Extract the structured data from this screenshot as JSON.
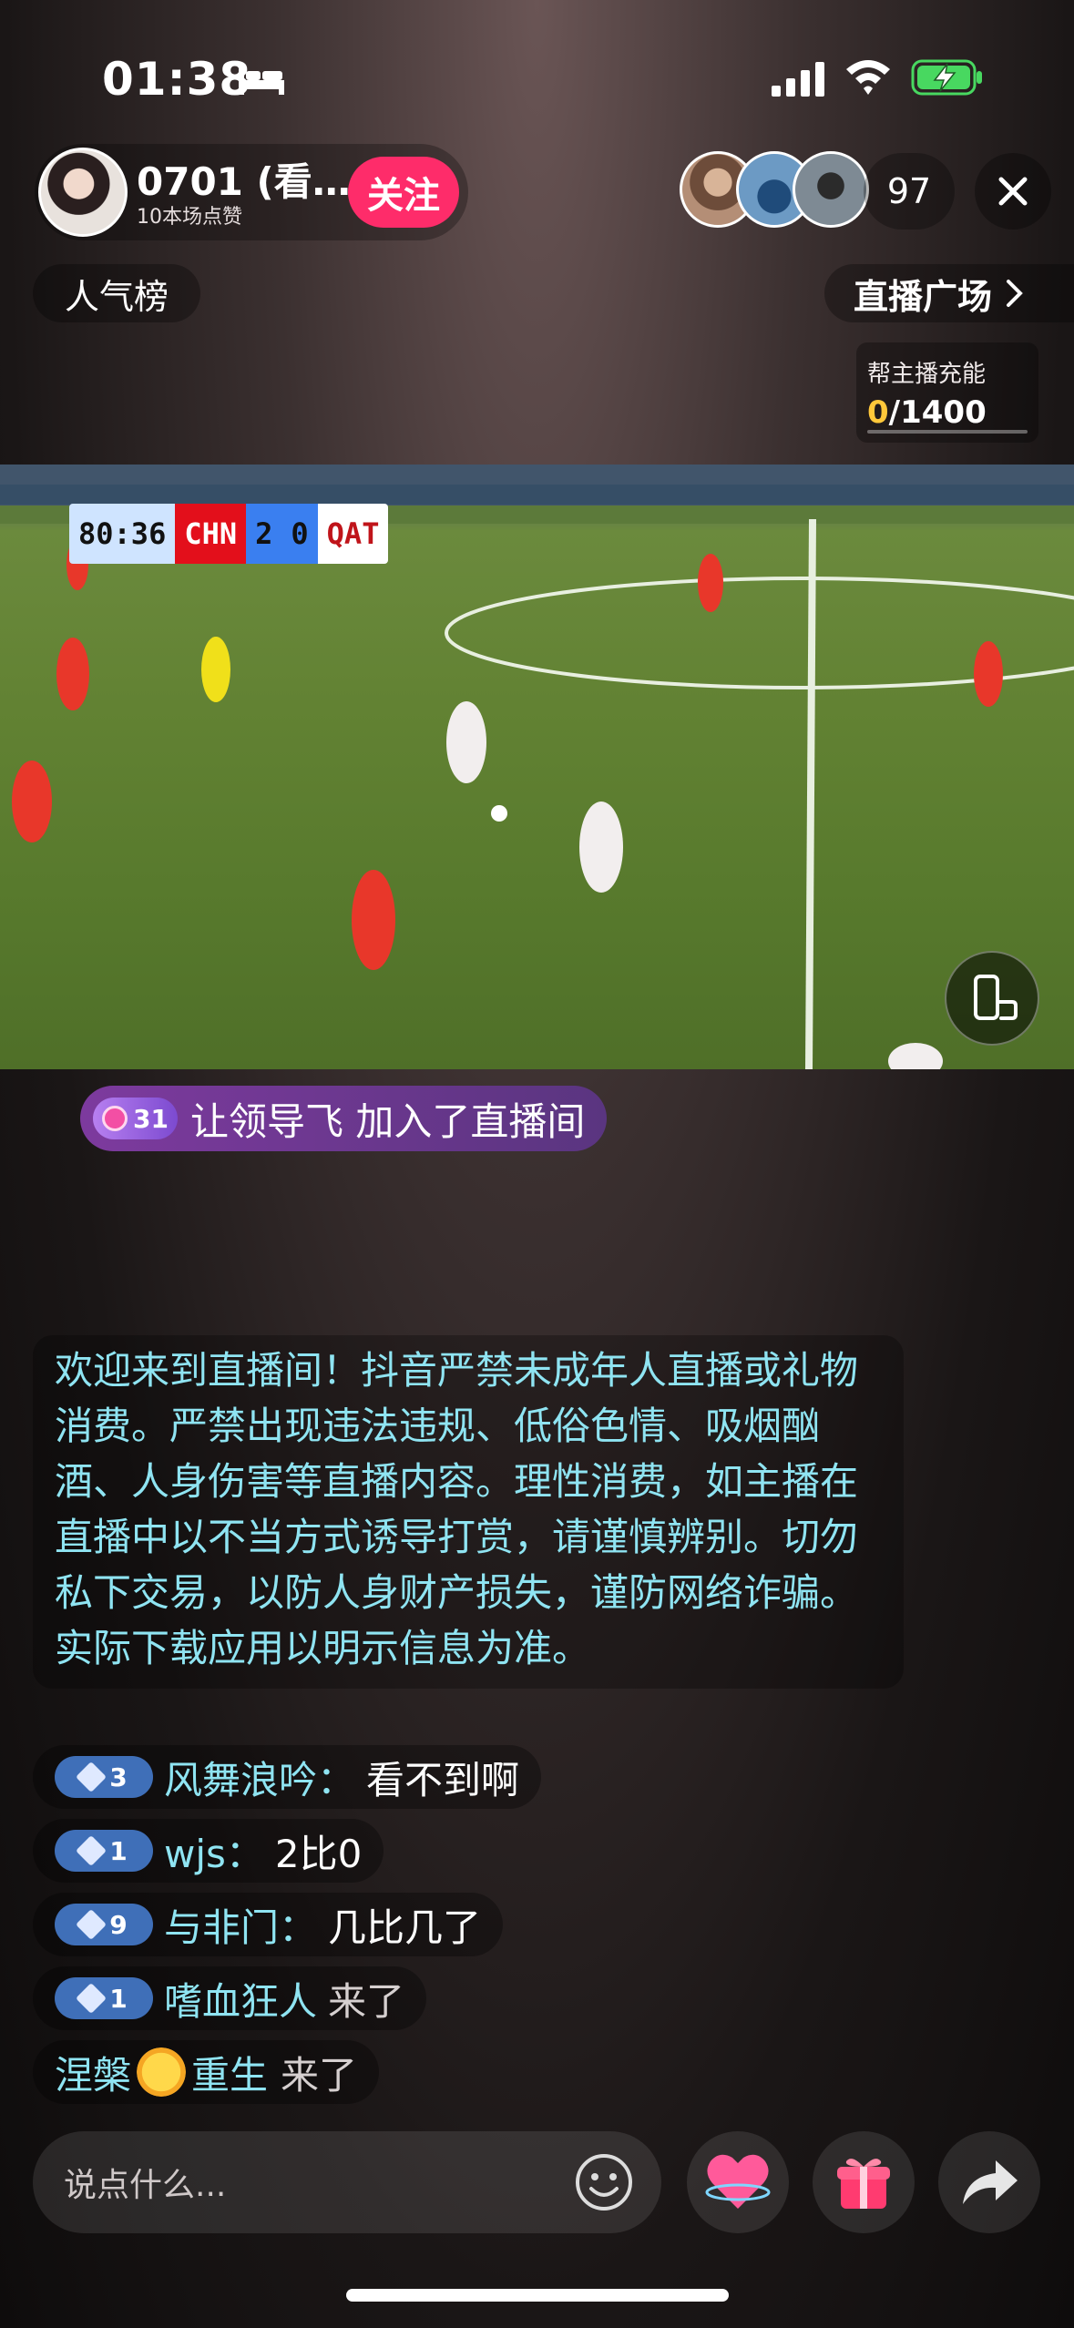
{
  "status_bar": {
    "time": "01:38"
  },
  "header": {
    "host_name": "0701 (看…",
    "host_likes": "10本场点赞",
    "follow_label": "关注",
    "viewer_count": "97"
  },
  "ranking_label": "人气榜",
  "plaza_label": "直播广场",
  "charge": {
    "title": "帮主播充能",
    "current": "0",
    "separator": "/",
    "target": "1400"
  },
  "scoreboard": {
    "clock": "80:36",
    "team1": "CHN",
    "score1": "2",
    "score2": "0",
    "team2": "QAT"
  },
  "join_notice": {
    "level": "31",
    "text": "让领导飞 加入了直播间"
  },
  "notice_text": "欢迎来到直播间！抖音严禁未成年人直播或礼物消费。严禁出现违法违规、低俗色情、吸烟酗酒、人身伤害等直播内容。理性消费，如主播在直播中以不当方式诱导打赏，请谨慎辨别。切勿私下交易，以防人身财产损失，谨防网络诈骗。实际下载应用以明示信息为准。",
  "comments": [
    {
      "level": "3",
      "user": "风舞浪吟：",
      "message": "看不到啊"
    },
    {
      "level": "1",
      "user": "wjs：",
      "message": "2比0"
    },
    {
      "level": "9",
      "user": "与非门：",
      "message": "几比几了"
    }
  ],
  "arrivals": [
    {
      "level": "1",
      "user": "嗜血狂人",
      "text": "来了"
    },
    {
      "user_a": "涅槃",
      "user_b": "重生",
      "text": "来了"
    }
  ],
  "input_placeholder": "说点什么...",
  "colors": {
    "follow": "#fe2c6a",
    "username": "#8fe4f2",
    "charge_current": "#ffc83a",
    "join_pill": "#7d3a9e"
  }
}
